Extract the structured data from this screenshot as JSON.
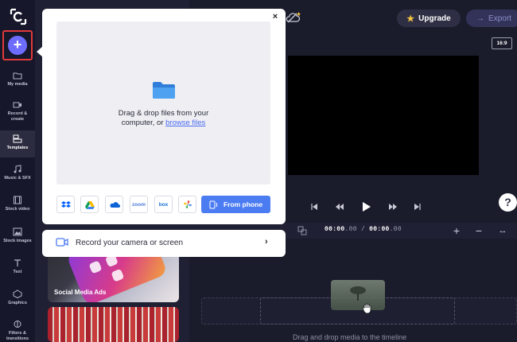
{
  "sidebar": {
    "add_label": "+",
    "items": [
      {
        "label": "My media",
        "icon": "folder-icon"
      },
      {
        "label": "Record & create",
        "icon": "record-icon"
      },
      {
        "label": "Templates",
        "icon": "templates-icon",
        "active": true
      },
      {
        "label": "Music & SFX",
        "icon": "music-icon"
      },
      {
        "label": "Stock video",
        "icon": "film-icon"
      },
      {
        "label": "Stock images",
        "icon": "image-icon"
      },
      {
        "label": "Text",
        "icon": "text-icon"
      },
      {
        "label": "Graphics",
        "icon": "shapes-icon"
      },
      {
        "label": "Filters & transitions",
        "icon": "filters-icon"
      }
    ]
  },
  "templates": {
    "cards": [
      {
        "label": "Social Media Ads"
      },
      {
        "label": ""
      }
    ]
  },
  "topbar": {
    "upgrade_label": "Upgrade",
    "export_label": "Export",
    "aspect_ratio": "16:9"
  },
  "upload_popup": {
    "close_label": "×",
    "drop_line1": "Drag & drop files from your",
    "drop_line2_prefix": "computer, or ",
    "browse_label": "browse files",
    "sources": [
      {
        "name": "dropbox",
        "label": ""
      },
      {
        "name": "google-drive",
        "label": ""
      },
      {
        "name": "onedrive",
        "label": ""
      },
      {
        "name": "zoom",
        "label": "zoom"
      },
      {
        "name": "box",
        "label": "box"
      },
      {
        "name": "google-photos",
        "label": ""
      }
    ],
    "from_phone_label": "From phone",
    "record_label": "Record your camera or screen",
    "record_chevron": "›"
  },
  "player": {
    "help_label": "?"
  },
  "timeline": {
    "current_time_main": "00:00",
    "current_time_frac": ".00",
    "separator": "/",
    "total_time_main": "00:00",
    "total_time_frac": ".00",
    "zoom_in": "+",
    "zoom_out": "−",
    "fit": "↔",
    "drop_hint": "Drag and drop media to the timeline"
  },
  "colors": {
    "accent": "#4c7cf2",
    "add_button": "#6d6cff",
    "highlight": "#e03a3a",
    "upgrade_star": "#f5c542"
  }
}
